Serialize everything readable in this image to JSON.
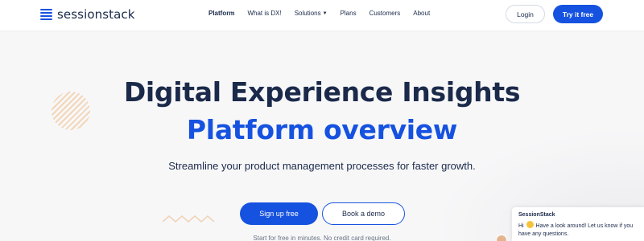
{
  "brand": {
    "name": "sessionstack",
    "logo_icon": "stack-lines-icon",
    "accent_color": "#1652e0"
  },
  "nav": {
    "items": [
      {
        "label": "Platform",
        "active": true
      },
      {
        "label": "What is DX!",
        "active": false
      },
      {
        "label": "Solutions",
        "active": false,
        "has_dropdown": true
      },
      {
        "label": "Plans",
        "active": false
      },
      {
        "label": "Customers",
        "active": false
      },
      {
        "label": "About",
        "active": false
      }
    ],
    "login_label": "Login",
    "try_label": "Try it free"
  },
  "hero": {
    "title": "Digital Experience Insights",
    "title_accent": "Platform overview",
    "subtitle": "Streamline your product management processes for faster growth.",
    "signup_label": "Sign up free",
    "demo_label": "Book a demo",
    "fine_print": "Start for free in minutes. No credit card required."
  },
  "chat": {
    "title": "SessionStack",
    "greeting": "Hi",
    "emoji": "smile-emoji",
    "message": "Have a look around! Let us know if you have any questions."
  }
}
